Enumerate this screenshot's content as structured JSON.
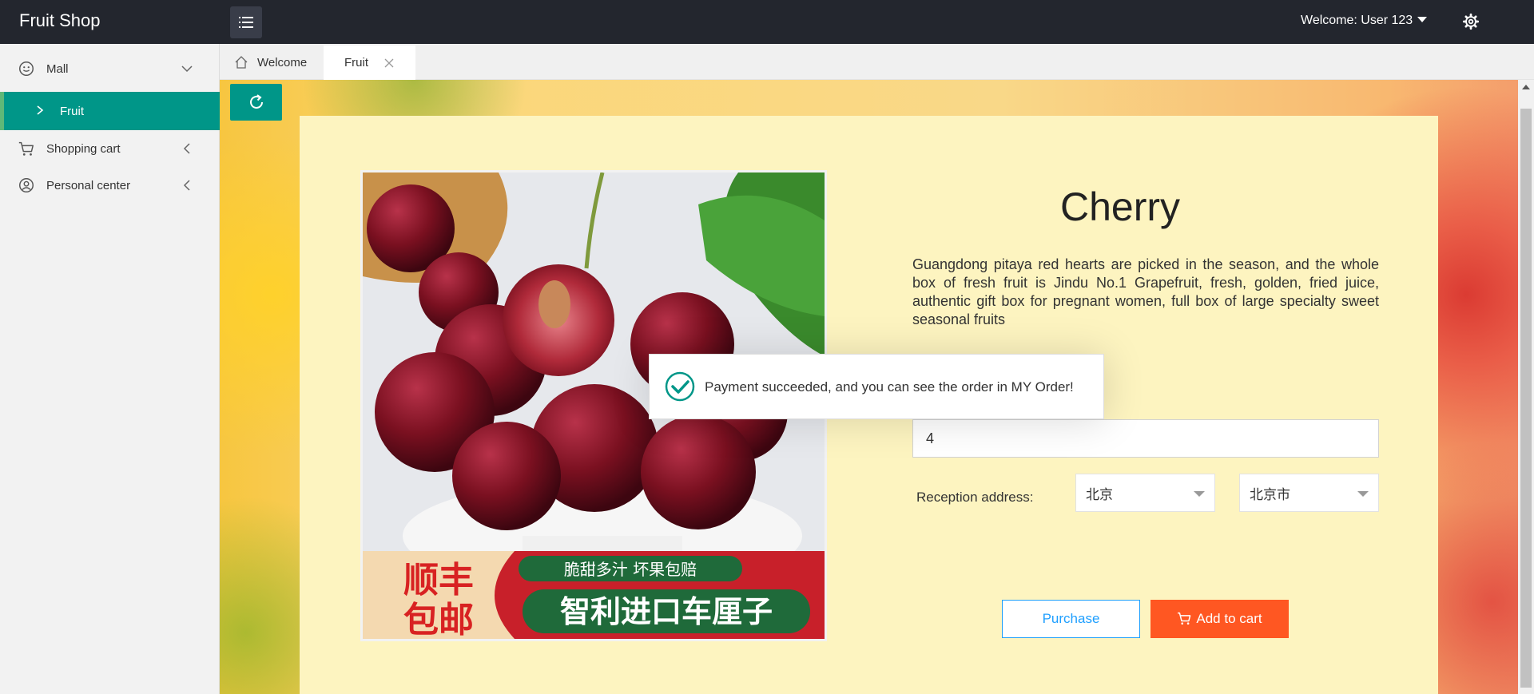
{
  "header": {
    "brand": "Fruit Shop",
    "welcome": "Welcome: User 123"
  },
  "sidebar": {
    "items": [
      {
        "label": "Mall",
        "icon": "smile-icon",
        "expanded": true
      },
      {
        "label": "Fruit",
        "selected": true
      },
      {
        "label": "Shopping cart",
        "icon": "cart-icon"
      },
      {
        "label": "Personal center",
        "icon": "user-icon"
      }
    ]
  },
  "tabs": [
    {
      "label": "Welcome",
      "icon": "home-icon"
    },
    {
      "label": "Fruit",
      "active": true
    }
  ],
  "product": {
    "name": "Cherry",
    "description": "Guangdong pitaya red hearts are picked in the season, and the whole box of fresh fruit is Jindu No.1 Grapefruit, fresh, golden, fried juice, authentic gift box for pregnant women, full box of large specialty sweet seasonal fruits",
    "quantity": "4",
    "address_label": "Reception address:",
    "province": "北京",
    "city": "北京市",
    "image_banner": {
      "left_text": "顺丰包邮",
      "top_text": "脆甜多汁 坏果包赔",
      "main_text": "智利进口车厘子"
    }
  },
  "buttons": {
    "purchase": "Purchase",
    "add_to_cart": "Add to cart"
  },
  "toast": {
    "message": "Payment succeeded, and you can see the order in MY Order!"
  },
  "colors": {
    "header_bg": "#23262e",
    "accent": "#009688",
    "cart_button": "#ff5722",
    "purchase_border": "#1e9fff",
    "panel_bg": "#fdf4c0"
  }
}
